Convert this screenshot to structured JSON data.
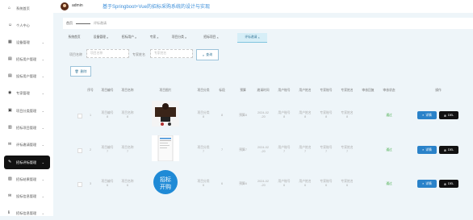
{
  "header": {
    "username": "admin",
    "app_title": "基于Springboot+Vue的招标采购系统的设计与实现"
  },
  "breadcrumb": {
    "home": "首页",
    "current": "评标邀请"
  },
  "sidebar": {
    "items": [
      {
        "label": "系统首页",
        "icon": "home-icon"
      },
      {
        "label": "个人中心",
        "icon": "user-icon"
      },
      {
        "label": "设备管理",
        "icon": "grid-icon"
      },
      {
        "label": "招标用户管理",
        "icon": "user-list-icon"
      },
      {
        "label": "投标用户管理",
        "icon": "user-list-icon"
      },
      {
        "label": "专家管理",
        "icon": "expert-icon"
      },
      {
        "label": "项目分类管理",
        "icon": "category-icon"
      },
      {
        "label": "招标项目管理",
        "icon": "project-icon"
      },
      {
        "label": "评标邀请管理",
        "icon": "invite-icon"
      },
      {
        "label": "招标评标管理",
        "icon": "evaluate-icon"
      },
      {
        "label": "招标结果管理",
        "icon": "result-icon"
      },
      {
        "label": "投标信息管理",
        "icon": "bid-icon"
      },
      {
        "label": "招标信息管理",
        "icon": "info-icon"
      }
    ]
  },
  "tabs": [
    {
      "label": "系统首页"
    },
    {
      "label": "设备管理"
    },
    {
      "label": "招标用户"
    },
    {
      "label": "专家"
    },
    {
      "label": "项目分类"
    },
    {
      "label": "招标项目"
    },
    {
      "label": "评标邀请"
    }
  ],
  "filters": {
    "project_name_label": "项目名称",
    "project_name_placeholder": "项目名称",
    "expert_name_label": "专家姓名",
    "expert_name_placeholder": "专家姓名",
    "search_label": "查询"
  },
  "toolbar": {
    "delete_label": "删除"
  },
  "table": {
    "headers": [
      "序号",
      "项目编号",
      "项目名称",
      "项目图片",
      "项目分类",
      "标段",
      "预算",
      "邀请时间",
      "用户账号",
      "用户姓名",
      "专家账号",
      "专家姓名",
      "审核回复",
      "审核状态",
      "操作"
    ],
    "rows": [
      {
        "index": "1",
        "project_no": "项目编号8",
        "project_name": "项目名称8",
        "category": "项目分类8",
        "section": "8",
        "budget": "预算8",
        "invite_time": "2024-02-20",
        "user_account": "用户账号8",
        "user_name": "用户姓名8",
        "expert_account": "专家账号8",
        "expert_name": "专家姓名8",
        "reply": "",
        "status": "通过"
      },
      {
        "index": "2",
        "project_no": "项目编号7",
        "project_name": "项目名称7",
        "category": "项目分类7",
        "section": "7",
        "budget": "预算7",
        "invite_time": "2024-02-20",
        "user_account": "用户账号7",
        "user_name": "用户姓名7",
        "expert_account": "专家账号7",
        "expert_name": "专家姓名7",
        "reply": "",
        "status": "通过"
      },
      {
        "index": "3",
        "project_no": "项目编号6",
        "project_name": "项目名称6",
        "category": "项目分类6",
        "section": "6",
        "budget": "预算6",
        "invite_time": "2024-02-20",
        "user_account": "用户账号6",
        "user_name": "用户姓名6",
        "expert_account": "专家账号6",
        "expert_name": "专家姓名6",
        "reply": "",
        "status": "通过"
      }
    ],
    "detail_label": "详情",
    "delete_label": "DEL"
  }
}
